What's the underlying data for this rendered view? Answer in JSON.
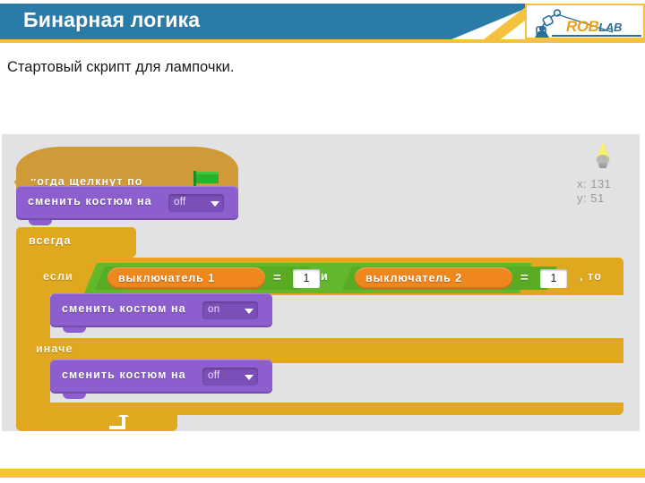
{
  "header": {
    "title": "Бинарная логика",
    "logo": {
      "part1": "ROB",
      "part2": "LAB",
      "icon": "robot-arm-icon"
    },
    "accent_color": "#f5c23e",
    "bar_color": "#2b7ba8"
  },
  "subtitle": "Стартовый скрипт для лампочки.",
  "sprite": {
    "icon": "lightbulb-icon",
    "x_label": "x: 131",
    "y_label": "y: 51"
  },
  "script": {
    "hat": {
      "label": "когда  щелкнут  по",
      "icon": "green-flag-icon",
      "color": "#d09a38"
    },
    "costume_off_top": {
      "label": "сменить  костюм  на",
      "value": "off",
      "color": "#8d5fce"
    },
    "forever": {
      "label": "всегда",
      "color": "#e0a81e",
      "loop_icon": "loop-arrow-icon"
    },
    "if_block": {
      "if_label": "если",
      "then_label": ", то",
      "and_label": "и",
      "else_label": "иначе",
      "operator_color": "#63b72b",
      "condition_left": {
        "variable": "выключатель 1",
        "operator": "=",
        "value": "1"
      },
      "condition_right": {
        "variable": "выключатель 2",
        "operator": "=",
        "value": "1"
      }
    },
    "costume_on": {
      "label": "сменить  костюм  на",
      "value": "on",
      "color": "#8d5fce"
    },
    "costume_off_bottom": {
      "label": "сменить  костюм  на",
      "value": "off",
      "color": "#8d5fce"
    }
  }
}
